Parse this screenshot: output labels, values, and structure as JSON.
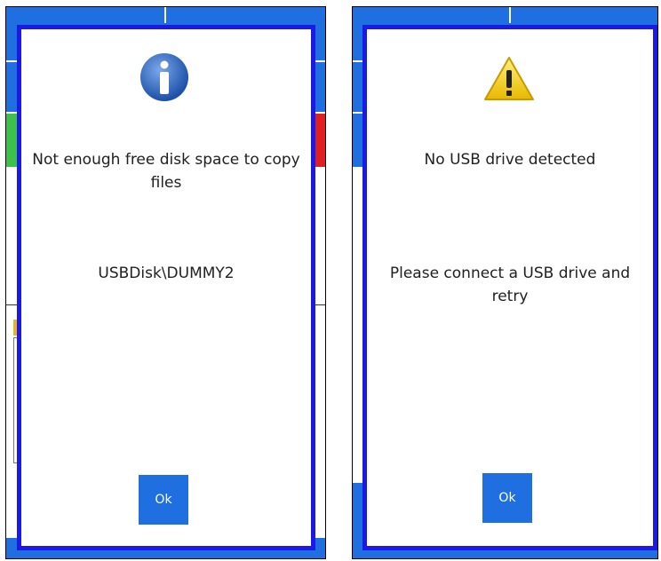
{
  "dialogs": [
    {
      "icon": "info-icon",
      "title": "Not enough free disk space to copy files",
      "detail": "USBDisk\\DUMMY2",
      "ok_label": "Ok"
    },
    {
      "icon": "warning-icon",
      "title": "No USB drive detected",
      "detail": "Please connect a USB drive and retry",
      "ok_label": "Ok"
    }
  ],
  "colors": {
    "dialog_border": "#1a19e6",
    "accent_blue": "#1f6fe0",
    "status_green": "#3cc14a",
    "status_red": "#e02020",
    "warning_yellow": "#f5d400"
  }
}
